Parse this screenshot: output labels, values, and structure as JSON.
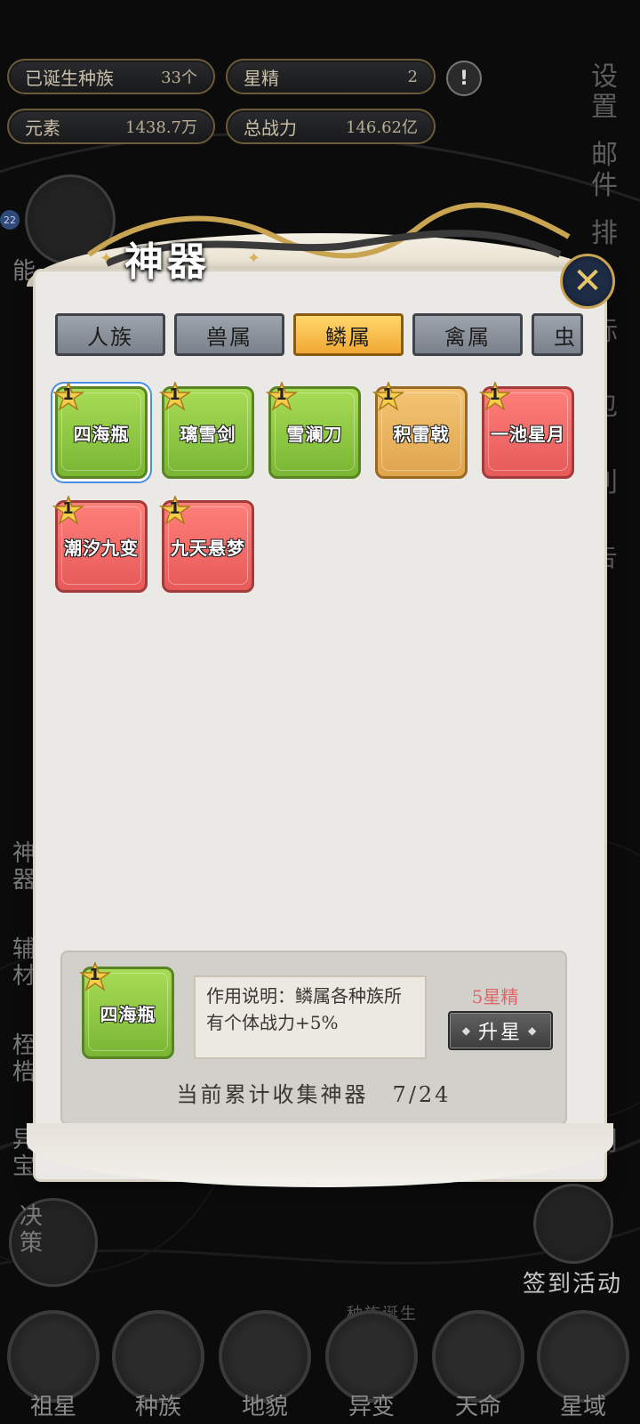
{
  "stats": {
    "races_born_label": "已诞生种族",
    "races_born_value": "33个",
    "star_essence_label": "星精",
    "star_essence_value": "2",
    "element_label": "元素",
    "element_value": "1438.7万",
    "total_power_label": "总战力",
    "total_power_value": "146.62亿",
    "alert_symbol": "!"
  },
  "right_menu": {
    "settings": "设置",
    "mail": "邮件",
    "rank_partial": "排",
    "hidden_1": "标",
    "hidden_2": "包",
    "hidden_3": "利",
    "hidden_4": "告",
    "pavilion_partial": "阁"
  },
  "left_menu": {
    "artifact": "神器",
    "auxiliary": "辅材",
    "hinoki": "桎梏",
    "treasure": "异宝",
    "decision": "决策",
    "level_partial": "能",
    "badge": "22"
  },
  "dialog": {
    "title": "神器",
    "close_symbol": "✕",
    "tabs": [
      {
        "label": "人族",
        "active": false
      },
      {
        "label": "兽属",
        "active": false
      },
      {
        "label": "鳞属",
        "active": true
      },
      {
        "label": "禽属",
        "active": false
      },
      {
        "label": "虫",
        "active": false
      }
    ],
    "artifacts": [
      {
        "name": "四海瓶",
        "stars": "1",
        "color": "green",
        "selected": true
      },
      {
        "name": "璃雪剑",
        "stars": "1",
        "color": "green",
        "selected": false
      },
      {
        "name": "雪澜刀",
        "stars": "1",
        "color": "green",
        "selected": false
      },
      {
        "name": "积雷戟",
        "stars": "1",
        "color": "orange",
        "selected": false
      },
      {
        "name": "一池星月",
        "stars": "1",
        "color": "red",
        "selected": false
      },
      {
        "name": "潮汐九变",
        "stars": "1",
        "color": "red",
        "selected": false
      },
      {
        "name": "九天悬梦",
        "stars": "1",
        "color": "red",
        "selected": false
      }
    ],
    "detail": {
      "name": "四海瓶",
      "stars": "1",
      "description": "作用说明：鳞属各种族所有个体战力+5%",
      "cost": "5星精",
      "upgrade_label": "升星",
      "collect_text": "当前累计收集神器　7/24"
    }
  },
  "bottom": {
    "checkin_activity": "签到活动",
    "race_birth": "种族诞生",
    "nav": [
      "祖星",
      "种族",
      "地貌",
      "异变",
      "天命",
      "星域"
    ]
  },
  "colors": {
    "green_card": "#8cc63f",
    "orange_card": "#e9b35f",
    "red_card": "#f06a66",
    "active_tab": "#f7c04a",
    "cost_text": "#e06565"
  }
}
